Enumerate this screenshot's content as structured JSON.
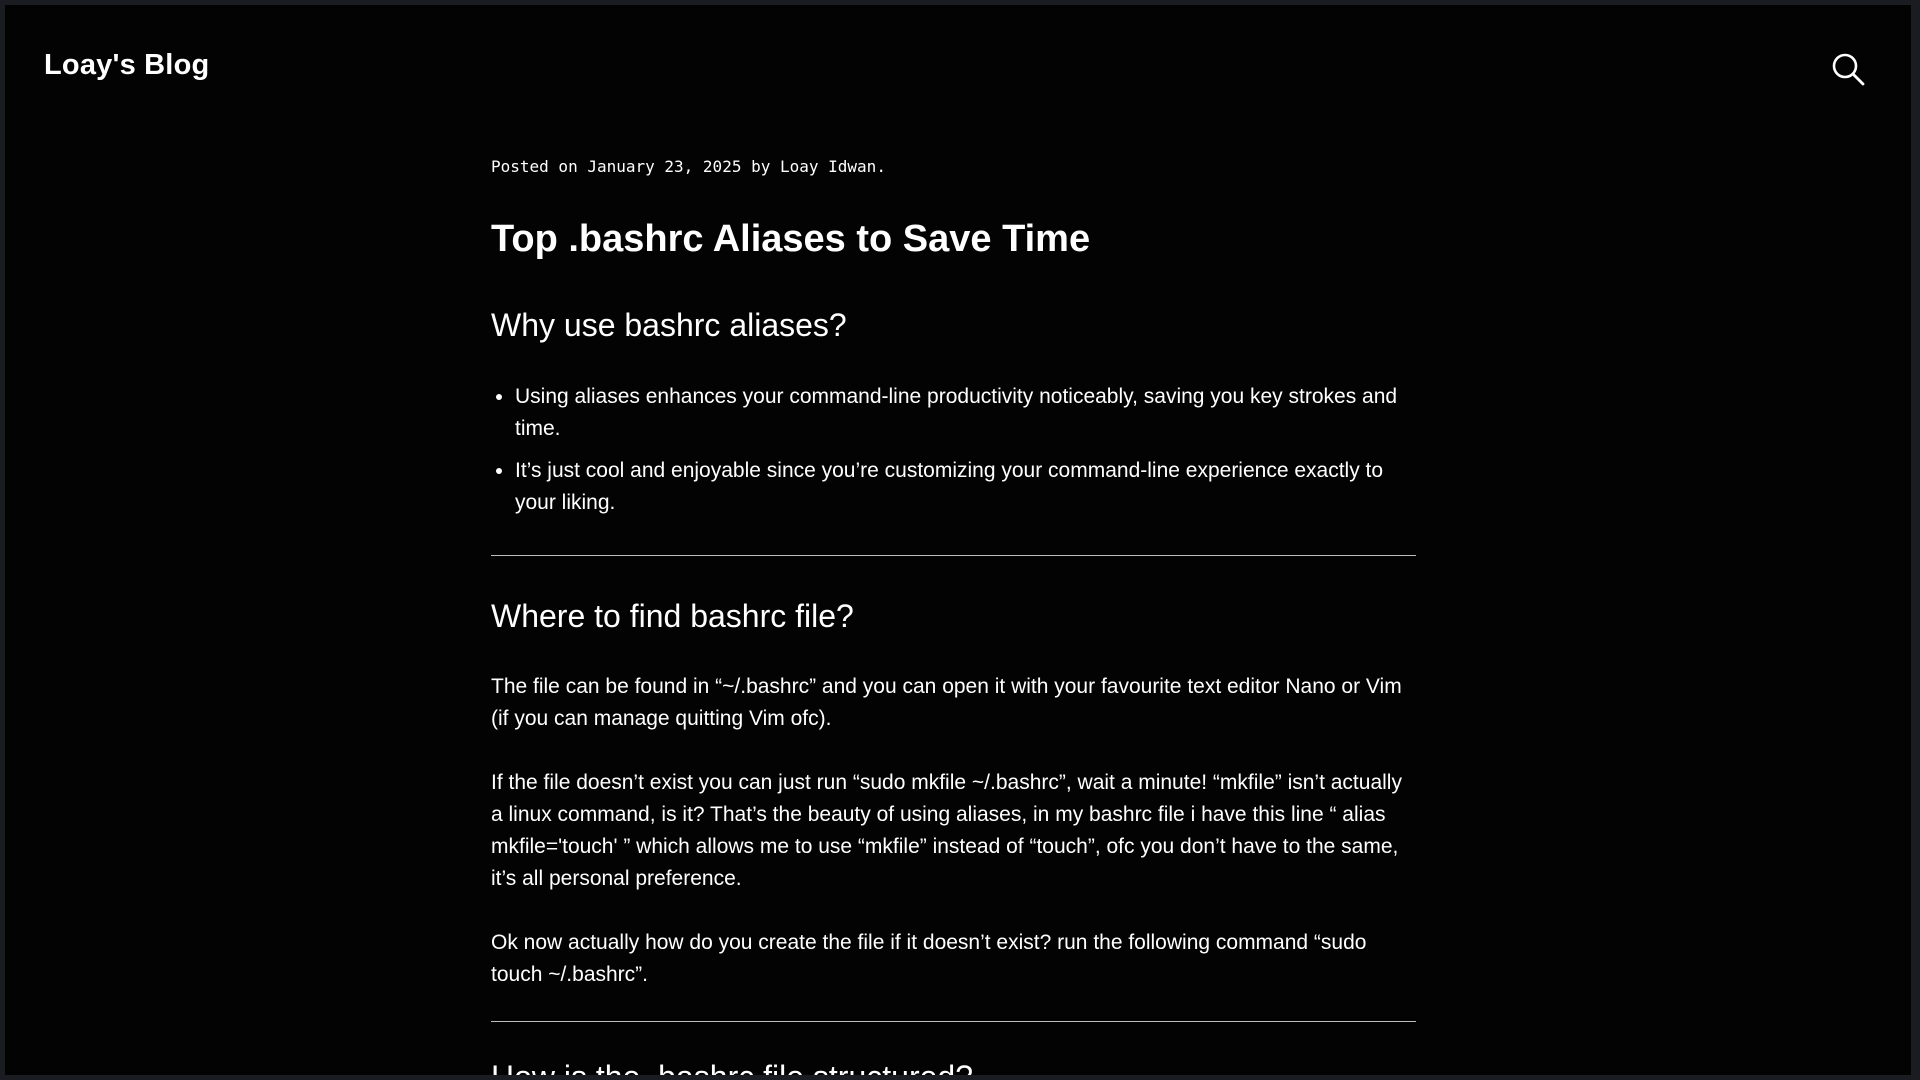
{
  "header": {
    "site_title": "Loay's Blog",
    "search_icon": "search-icon"
  },
  "post": {
    "meta": "Posted on January 23, 2025 by Loay Idwan.",
    "title": "Top .bashrc Aliases to Save Time",
    "sections": [
      {
        "heading": "Why use bashrc aliases?",
        "bullets": [
          "Using aliases enhances your command-line productivity noticeably, saving you key strokes and time.",
          "It’s just cool and enjoyable since you’re customizing your command-line experience exactly to your liking."
        ]
      },
      {
        "heading": "Where to find bashrc file?",
        "paragraphs": [
          "The file can be found in “~/.bashrc” and you can open it with your favourite text editor Nano or Vim (if you can manage quitting Vim ofc).",
          "If the file doesn’t exist you can just run “sudo mkfile ~/.bashrc”, wait a minute! “mkfile” isn’t actually a linux command, is it? That’s the beauty of using aliases, in my bashrc file i have this line “ alias mkfile='touch' ” which allows me to use “mkfile” instead of “touch”, ofc you don’t have to the same, it’s all personal preference.",
          "Ok now actually how do you create the file if it doesn’t exist? run the following command “sudo touch ~/.bashrc”."
        ]
      },
      {
        "heading": "How is the .bashrc file structured?"
      }
    ]
  },
  "colors": {
    "background": "#030303",
    "outer_frame": "#1b1b22",
    "text": "#ffffff",
    "rule": "#bdbdbd"
  }
}
